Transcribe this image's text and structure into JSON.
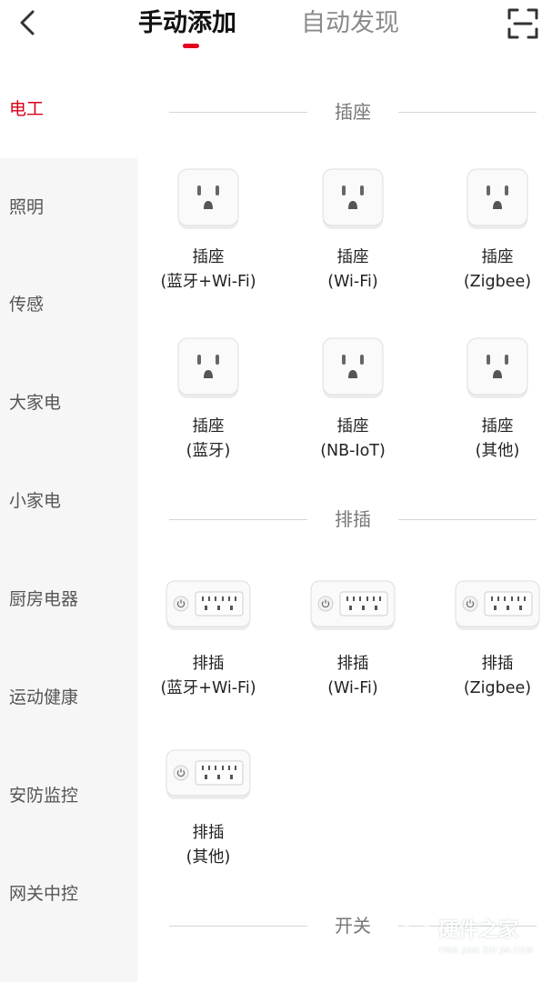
{
  "header": {
    "back_icon": "chevron-left-icon",
    "tabs": [
      {
        "label": "手动添加",
        "active": true
      },
      {
        "label": "自动发现",
        "active": false
      }
    ],
    "scan_icon": "scan-icon",
    "accent_color": "#e3001b"
  },
  "sidebar": {
    "items": [
      {
        "label": "电工",
        "active": true
      },
      {
        "label": "照明",
        "active": false
      },
      {
        "label": "传感",
        "active": false
      },
      {
        "label": "大家电",
        "active": false
      },
      {
        "label": "小家电",
        "active": false
      },
      {
        "label": "厨房电器",
        "active": false
      },
      {
        "label": "运动健康",
        "active": false
      },
      {
        "label": "安防监控",
        "active": false
      },
      {
        "label": "网关中控",
        "active": false
      }
    ]
  },
  "sections": [
    {
      "title": "插座",
      "devices": [
        {
          "name": "插座",
          "variant": "(蓝牙+Wi-Fi)",
          "icon": "socket-icon"
        },
        {
          "name": "插座",
          "variant": "(Wi-Fi)",
          "icon": "socket-icon"
        },
        {
          "name": "插座",
          "variant": "(Zigbee)",
          "icon": "socket-icon"
        },
        {
          "name": "插座",
          "variant": "(蓝牙)",
          "icon": "socket-icon"
        },
        {
          "name": "插座",
          "variant": "(NB-IoT)",
          "icon": "socket-icon"
        },
        {
          "name": "插座",
          "variant": "(其他)",
          "icon": "socket-icon"
        }
      ]
    },
    {
      "title": "排插",
      "devices": [
        {
          "name": "排插",
          "variant": "(蓝牙+Wi-Fi)",
          "icon": "power-strip-icon"
        },
        {
          "name": "排插",
          "variant": "(Wi-Fi)",
          "icon": "power-strip-icon"
        },
        {
          "name": "排插",
          "variant": "(Zigbee)",
          "icon": "power-strip-icon"
        },
        {
          "name": "排插",
          "variant": "(其他)",
          "icon": "power-strip-icon"
        }
      ]
    },
    {
      "title": "开关",
      "devices": []
    }
  ],
  "watermark": {
    "text": "硬件之家",
    "sub": "YING JIAN ZHI JIA.COM"
  }
}
